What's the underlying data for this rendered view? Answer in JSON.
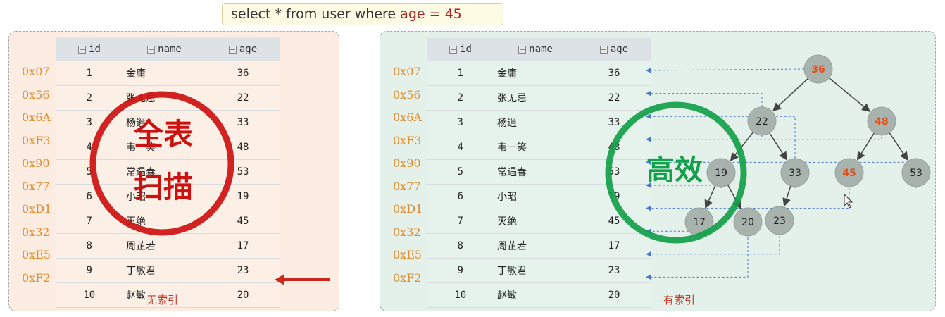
{
  "query": {
    "prefix": "select * from user where ",
    "highlight": "age = 45"
  },
  "columns": [
    "id",
    "name",
    "age"
  ],
  "rows": [
    {
      "addr": "0x07",
      "id": "1",
      "name": "金庸",
      "age": "36"
    },
    {
      "addr": "0x56",
      "id": "2",
      "name": "张无忌",
      "age": "22"
    },
    {
      "addr": "0x6A",
      "id": "3",
      "name": "杨逍",
      "age": "33"
    },
    {
      "addr": "0xF3",
      "id": "4",
      "name": "韦一笑",
      "age": "48"
    },
    {
      "addr": "0x90",
      "id": "5",
      "name": "常遇春",
      "age": "53"
    },
    {
      "addr": "0x77",
      "id": "6",
      "name": "小昭",
      "age": "19"
    },
    {
      "addr": "0xD1",
      "id": "7",
      "name": "灭绝",
      "age": "45"
    },
    {
      "addr": "0x32",
      "id": "8",
      "name": "周芷若",
      "age": "17"
    },
    {
      "addr": "0xE5",
      "id": "9",
      "name": "丁敏君",
      "age": "23"
    },
    {
      "addr": "0xF2",
      "id": "10",
      "name": "赵敏",
      "age": "20"
    }
  ],
  "left": {
    "caption": "无索引",
    "stamp_line1": "全表",
    "stamp_line2": "扫描"
  },
  "right": {
    "caption": "有索引",
    "stamp": "高效"
  },
  "tree_nodes": [
    "36",
    "22",
    "48",
    "19",
    "33",
    "45",
    "53",
    "17",
    "20",
    "23"
  ],
  "colors": {
    "highlight": "#e0501a",
    "node": "#a9b3ad",
    "left_stamp": "#cc1111",
    "right_stamp": "#13a04a",
    "address": "#e08c2c"
  }
}
